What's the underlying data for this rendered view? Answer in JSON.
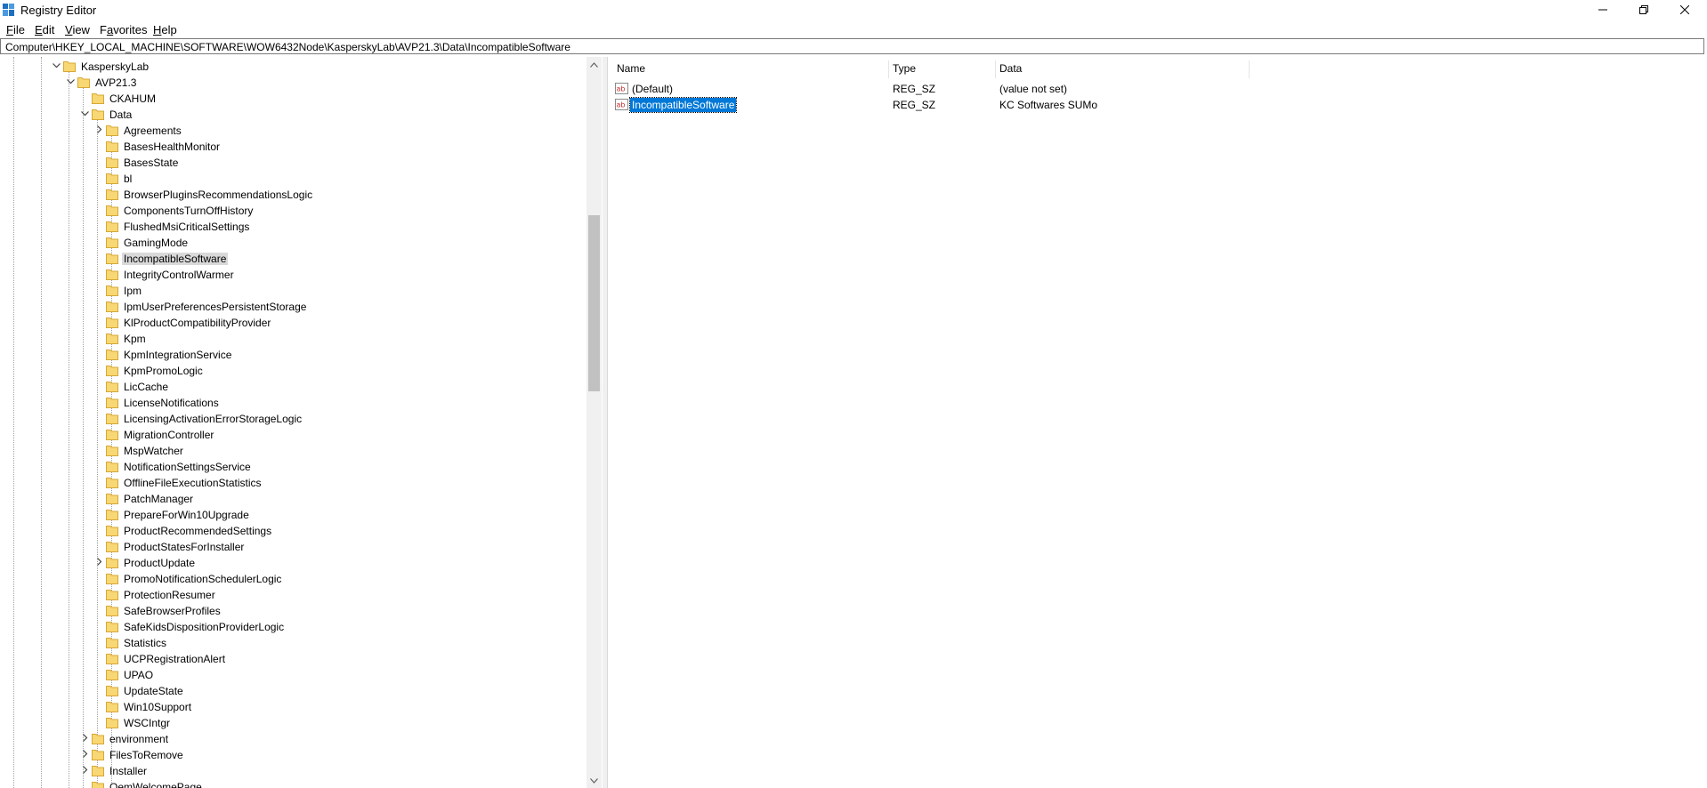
{
  "window": {
    "title": "Registry Editor"
  },
  "menu": [
    {
      "pre": "",
      "acc": "F",
      "post": "ile"
    },
    {
      "pre": "",
      "acc": "E",
      "post": "dit"
    },
    {
      "pre": "",
      "acc": "V",
      "post": "iew"
    },
    {
      "pre": "F",
      "acc": "a",
      "post": "vorites"
    },
    {
      "pre": "",
      "acc": "H",
      "post": "elp"
    }
  ],
  "address": "Computer\\HKEY_LOCAL_MACHINE\\SOFTWARE\\WOW6432Node\\KasperskyLab\\AVP21.3\\Data\\IncompatibleSoftware",
  "tree": [
    {
      "label": "KasperskyLab",
      "level": 0,
      "exp": "open"
    },
    {
      "label": "AVP21.3",
      "level": 1,
      "exp": "open"
    },
    {
      "label": "CKAHUM",
      "level": 2,
      "exp": ""
    },
    {
      "label": "Data",
      "level": 2,
      "exp": "open"
    },
    {
      "label": "Agreements",
      "level": 3,
      "exp": "closed"
    },
    {
      "label": "BasesHealthMonitor",
      "level": 3,
      "exp": ""
    },
    {
      "label": "BasesState",
      "level": 3,
      "exp": ""
    },
    {
      "label": "bl",
      "level": 3,
      "exp": ""
    },
    {
      "label": "BrowserPluginsRecommendationsLogic",
      "level": 3,
      "exp": ""
    },
    {
      "label": "ComponentsTurnOffHistory",
      "level": 3,
      "exp": ""
    },
    {
      "label": "FlushedMsiCriticalSettings",
      "level": 3,
      "exp": ""
    },
    {
      "label": "GamingMode",
      "level": 3,
      "exp": ""
    },
    {
      "label": "IncompatibleSoftware",
      "level": 3,
      "exp": "",
      "selected": true
    },
    {
      "label": "IntegrityControlWarmer",
      "level": 3,
      "exp": ""
    },
    {
      "label": "Ipm",
      "level": 3,
      "exp": ""
    },
    {
      "label": "IpmUserPreferencesPersistentStorage",
      "level": 3,
      "exp": ""
    },
    {
      "label": "KlProductCompatibilityProvider",
      "level": 3,
      "exp": ""
    },
    {
      "label": "Kpm",
      "level": 3,
      "exp": ""
    },
    {
      "label": "KpmIntegrationService",
      "level": 3,
      "exp": ""
    },
    {
      "label": "KpmPromoLogic",
      "level": 3,
      "exp": ""
    },
    {
      "label": "LicCache",
      "level": 3,
      "exp": ""
    },
    {
      "label": "LicenseNotifications",
      "level": 3,
      "exp": ""
    },
    {
      "label": "LicensingActivationErrorStorageLogic",
      "level": 3,
      "exp": ""
    },
    {
      "label": "MigrationController",
      "level": 3,
      "exp": ""
    },
    {
      "label": "MspWatcher",
      "level": 3,
      "exp": ""
    },
    {
      "label": "NotificationSettingsService",
      "level": 3,
      "exp": ""
    },
    {
      "label": "OfflineFileExecutionStatistics",
      "level": 3,
      "exp": ""
    },
    {
      "label": "PatchManager",
      "level": 3,
      "exp": ""
    },
    {
      "label": "PrepareForWin10Upgrade",
      "level": 3,
      "exp": ""
    },
    {
      "label": "ProductRecommendedSettings",
      "level": 3,
      "exp": ""
    },
    {
      "label": "ProductStatesForInstaller",
      "level": 3,
      "exp": ""
    },
    {
      "label": "ProductUpdate",
      "level": 3,
      "exp": "closed"
    },
    {
      "label": "PromoNotificationSchedulerLogic",
      "level": 3,
      "exp": ""
    },
    {
      "label": "ProtectionResumer",
      "level": 3,
      "exp": ""
    },
    {
      "label": "SafeBrowserProfiles",
      "level": 3,
      "exp": ""
    },
    {
      "label": "SafeKidsDispositionProviderLogic",
      "level": 3,
      "exp": ""
    },
    {
      "label": "Statistics",
      "level": 3,
      "exp": ""
    },
    {
      "label": "UCPRegistrationAlert",
      "level": 3,
      "exp": ""
    },
    {
      "label": "UPAO",
      "level": 3,
      "exp": ""
    },
    {
      "label": "UpdateState",
      "level": 3,
      "exp": ""
    },
    {
      "label": "Win10Support",
      "level": 3,
      "exp": ""
    },
    {
      "label": "WSCIntgr",
      "level": 3,
      "exp": ""
    },
    {
      "label": "environment",
      "level": 2,
      "exp": "closed"
    },
    {
      "label": "FilesToRemove",
      "level": 2,
      "exp": "closed"
    },
    {
      "label": "Installer",
      "level": 2,
      "exp": "closed"
    },
    {
      "label": "OemWelcomePage",
      "level": 2,
      "exp": ""
    }
  ],
  "columns": {
    "name": "Name",
    "type": "Type",
    "data": "Data"
  },
  "values": [
    {
      "name": "(Default)",
      "type": "REG_SZ",
      "data": "(value not set)"
    },
    {
      "name": "IncompatibleSoftware",
      "type": "REG_SZ",
      "data": "KC Softwares SUMo",
      "selected": true
    }
  ],
  "colors": {
    "selection": "#0078d7",
    "folder": "#f8d775",
    "inactive_selection": "#d9d9d9"
  },
  "icons": {
    "app": "registry-editor-icon",
    "folder": "folder-icon",
    "value": "string-value-icon"
  }
}
